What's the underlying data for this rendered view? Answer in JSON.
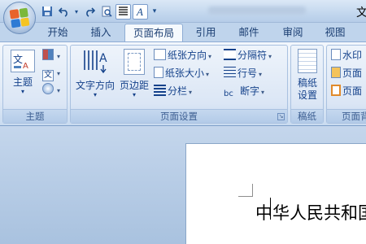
{
  "window": {
    "title_fragment": "文"
  },
  "qat": {
    "items": [
      {
        "name": "save-icon",
        "glyph": "💾"
      },
      {
        "name": "undo-icon",
        "glyph": "↶"
      },
      {
        "name": "redo-icon",
        "glyph": "↷"
      },
      {
        "name": "print-preview-icon",
        "glyph": "🔍"
      },
      {
        "name": "align-icon",
        "glyph": "≡"
      },
      {
        "name": "font-style-icon",
        "glyph": "A"
      }
    ]
  },
  "tabs": [
    {
      "label": "开始"
    },
    {
      "label": "插入"
    },
    {
      "label": "页面布局",
      "active": true
    },
    {
      "label": "引用"
    },
    {
      "label": "邮件"
    },
    {
      "label": "审阅"
    },
    {
      "label": "视图"
    }
  ],
  "ribbon": {
    "groups": {
      "theme": {
        "label": "主题",
        "theme_button": "主题"
      },
      "page_setup": {
        "label": "页面设置",
        "text_direction": "文字方向",
        "margins": "页边距",
        "orientation": "纸张方向",
        "size": "纸张大小",
        "columns": "分栏",
        "breaks": "分隔符",
        "line_numbers": "行号",
        "hyphenation": "断字"
      },
      "manuscript": {
        "label": "稿纸",
        "manuscript_setup_line1": "稿纸",
        "manuscript_setup_line2": "设置"
      },
      "page_background": {
        "label": "页面背",
        "watermark": "水印",
        "page_color": "页面",
        "page_border": "页面"
      }
    }
  },
  "document": {
    "text": "中华人民共和国"
  },
  "colors": {
    "accent": "#15428b",
    "ribbon_bg": "#dde8f6",
    "workspace": "#a9c2df"
  }
}
